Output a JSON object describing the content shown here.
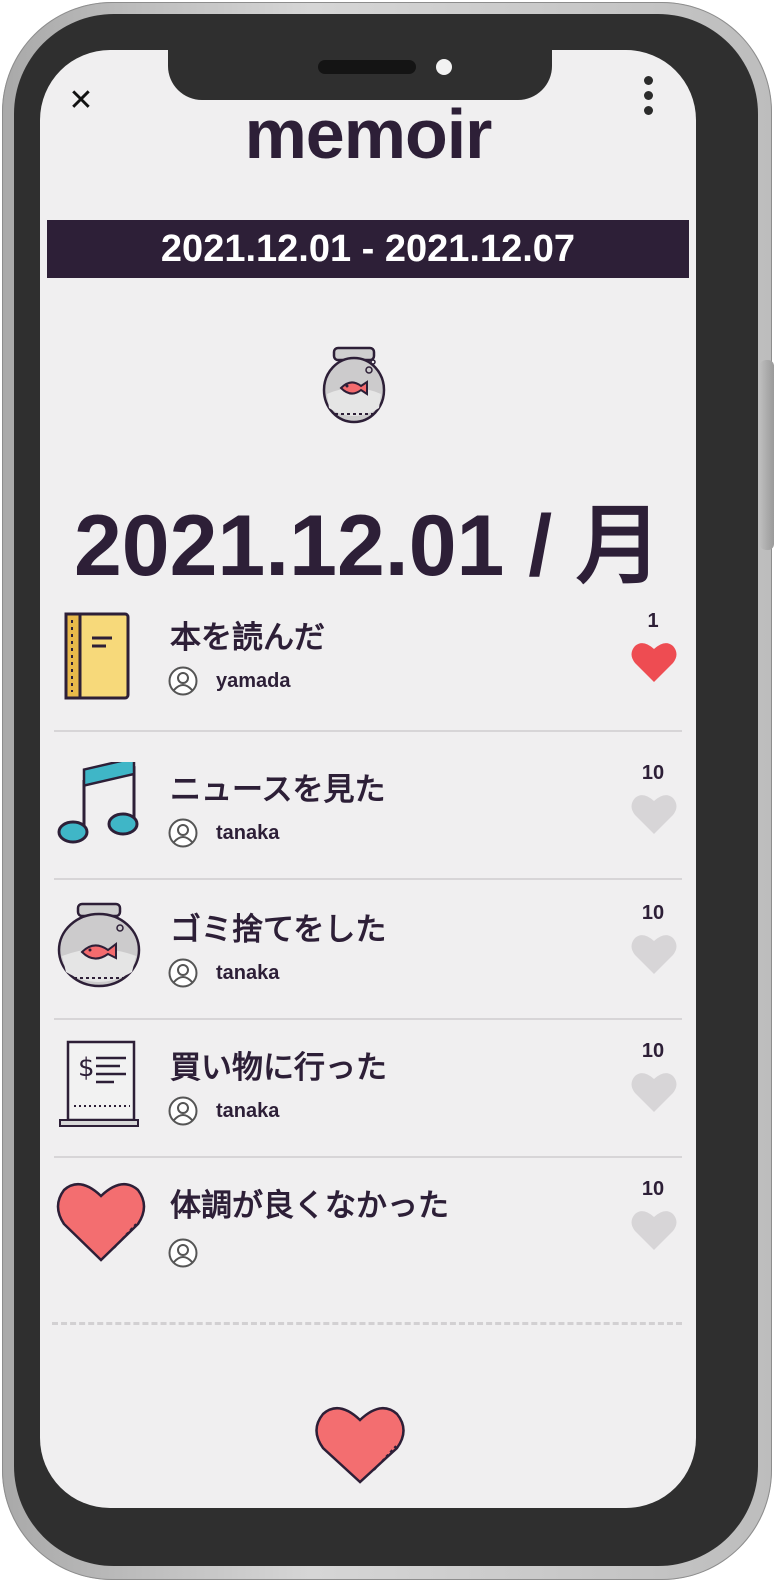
{
  "app": {
    "title": "memoir"
  },
  "header": {
    "close_glyph": "✕",
    "menu_icon": "kebab-menu-icon"
  },
  "week_range": "2021.12.01 - 2021.12.07",
  "day": {
    "icon": "fishbowl-icon",
    "title": "2021.12.01 / 月"
  },
  "entries": [
    {
      "title": "本を読んだ",
      "user": "yamada",
      "likes": "1",
      "liked": true,
      "icon": "notebook-icon"
    },
    {
      "title": "ニュースを見た",
      "user": "tanaka",
      "likes": "10",
      "liked": false,
      "icon": "music-note-icon"
    },
    {
      "title": "ゴミ捨てをした",
      "user": "tanaka",
      "likes": "10",
      "liked": false,
      "icon": "fishbowl-icon"
    },
    {
      "title": "買い物に行った",
      "user": "tanaka",
      "likes": "10",
      "liked": false,
      "icon": "receipt-icon"
    },
    {
      "title": "体調が良くなかった",
      "user": "",
      "likes": "10",
      "liked": false,
      "icon": "heart-icon"
    }
  ],
  "colors": {
    "primary": "#2d1f37",
    "background": "#f0eff0",
    "heart_active": "#ee4c52",
    "heart_inactive": "#d7d5d7",
    "heart_large": "#f36e70"
  },
  "bottom_action": {
    "icon": "heart-icon"
  }
}
